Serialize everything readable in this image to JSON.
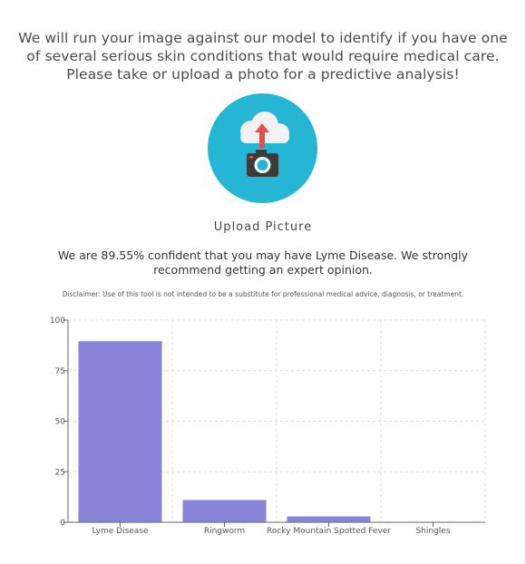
{
  "intro_text": "We will run your image against our model to identify if you have one of several serious skin conditions that would require medical care. Please take or upload a photo for a predictive analysis!",
  "upload": {
    "label": "Upload Picture",
    "icon": "camera-upload-icon",
    "circle_color": "#24b6d4"
  },
  "result_text": "We are 89.55% confident that you may have Lyme Disease. We strongly recommend getting an expert opinion.",
  "disclaimer": "Disclaimer: Use of this tool is not intended to be a substitute for professional medical advice, diagnosis, or treatment.",
  "chart_data": {
    "type": "bar",
    "categories": [
      "Lyme Disease",
      "Ringworm",
      "Rocky Mountain Spotted Fever",
      "Shingles"
    ],
    "values": [
      89.55,
      11,
      2.9,
      0.1
    ],
    "ylim": [
      0,
      100
    ],
    "yticks": [
      0,
      25,
      50,
      75,
      100
    ],
    "grid": true,
    "bar_color": "#8884d8"
  }
}
